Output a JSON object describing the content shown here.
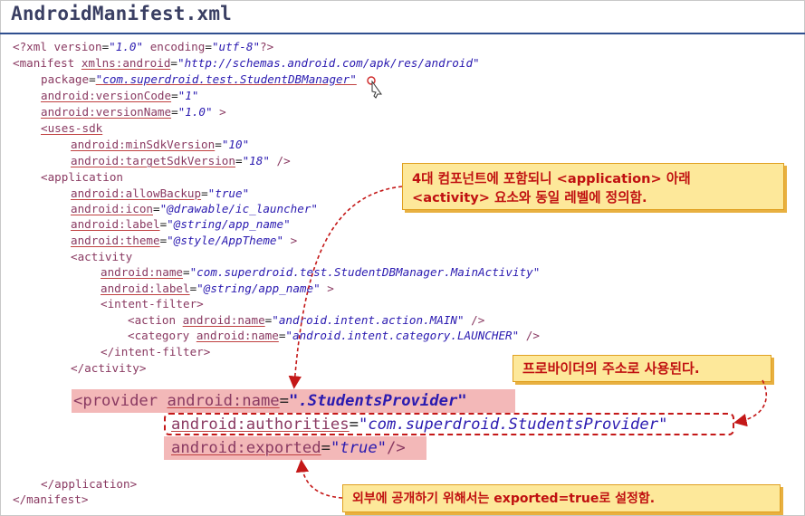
{
  "title": "AndroidManifest.xml",
  "code": {
    "xml_decl": {
      "open": "<?xml ",
      "attr1": "version",
      "eq1": "=",
      "val1": "\"1.0\"",
      "attr2": "encoding",
      "eq2": "=",
      "val2": "\"utf-8\"",
      "close": "?>"
    },
    "manifest_open": {
      "tag": "<manifest ",
      "attr": "xmlns:android",
      "eq": "=",
      "val": "\"http://schemas.android.com/apk/res/android\""
    },
    "package_line": {
      "attr": "package",
      "eq": "=",
      "val": "\"com.superdroid.test.StudentDBManager\""
    },
    "version_code": {
      "attr": "android:versionCode",
      "eq": "=",
      "val": "\"1\""
    },
    "version_name": {
      "attr": "android:versionName",
      "eq": "=",
      "val": "\"1.0\"",
      "close": " >"
    },
    "uses_sdk": "<uses-sdk",
    "min_sdk": {
      "attr": "android:minSdkVersion",
      "eq": "=",
      "val": "\"10\""
    },
    "target_sdk": {
      "attr": "android:targetSdkVersion",
      "eq": "=",
      "val": "\"18\"",
      "close": " />"
    },
    "application_open": "<application",
    "allow_backup": {
      "attr": "android:allowBackup",
      "eq": "=",
      "val": "\"true\""
    },
    "icon": {
      "attr": "android:icon",
      "eq": "=",
      "val": "\"@drawable/ic_launcher\""
    },
    "label": {
      "attr": "android:label",
      "eq": "=",
      "val": "\"@string/app_name\""
    },
    "theme": {
      "attr": "android:theme",
      "eq": "=",
      "val": "\"@style/AppTheme\"",
      "close": " >"
    },
    "activity_open": "<activity",
    "activity_name": {
      "attr": "android:name",
      "eq": "=",
      "val": "\"com.superdroid.test.StudentDBManager.MainActivity\""
    },
    "activity_label": {
      "attr": "android:label",
      "eq": "=",
      "val": "\"@string/app_name\"",
      "close": " >"
    },
    "intent_filter_open": "<intent-filter>",
    "action": {
      "tag": "<action ",
      "attr": "android:name",
      "eq": "=",
      "val": "\"android.intent.action.MAIN\"",
      "close": " />"
    },
    "category": {
      "tag": "<category ",
      "attr": "android:name",
      "eq": "=",
      "val": "\"android.intent.category.LAUNCHER\"",
      "close": " />"
    },
    "intent_filter_close": "</intent-filter>",
    "activity_close": "</activity>",
    "provider": {
      "tag": "<provider ",
      "attr": "android:name",
      "eq": "=",
      "val": "\".StudentsProvider\""
    },
    "authorities": {
      "attr": "android:authorities",
      "eq": "=",
      "val": "\"com.superdroid.StudentsProvider\""
    },
    "exported": {
      "attr": "android:exported",
      "eq": "=",
      "val": "\"true\"",
      "close": "/>"
    },
    "application_close": "</application>",
    "manifest_close": "</manifest>"
  },
  "notes": {
    "note1_line1": "4대 컴포넌트에 포함되니 <application> 아래",
    "note1_line2": "<activity> 요소와 동일 레벨에 정의함.",
    "note2": "프로바이더의 주소로 사용된다.",
    "note3": "외부에 공개하기 위해서는 exported=true로 설정함."
  },
  "colors": {
    "tag": "#8a3a62",
    "value": "#2a1ab0",
    "note_bg": "#fde89a",
    "note_text": "#c01010",
    "highlight": "#f3b8b8",
    "arrow": "#c41818"
  }
}
